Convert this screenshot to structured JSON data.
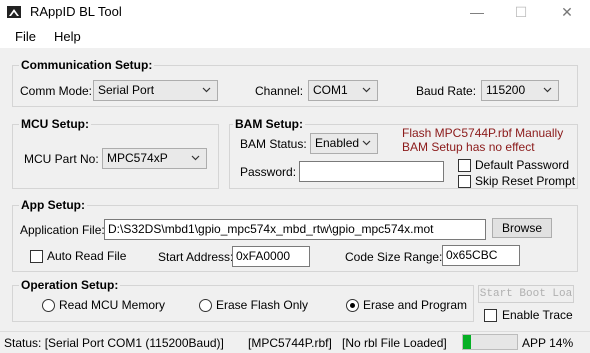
{
  "window": {
    "title": "RAppID BL Tool",
    "minimize": "—",
    "maximize": "☐",
    "close": "✕"
  },
  "menu": {
    "file": "File",
    "help": "Help"
  },
  "comm": {
    "title": "Communication Setup:",
    "mode_label": "Comm Mode:",
    "mode_value": "Serial Port",
    "channel_label": "Channel:",
    "channel_value": "COM1",
    "baud_label": "Baud Rate:",
    "baud_value": "115200"
  },
  "mcu": {
    "title": "MCU Setup:",
    "part_label": "MCU Part No:",
    "part_value": "MPC574xP"
  },
  "bam": {
    "title": "BAM Setup:",
    "status_label": "BAM Status:",
    "status_value": "Enabled",
    "note_line1": "Flash MPC5744P.rbf Manually",
    "note_line2": "BAM Setup has no effect",
    "password_label": "Password:",
    "password_value": "",
    "default_password": "Default Password",
    "skip_reset": "Skip Reset Prompt"
  },
  "app": {
    "title": "App Setup:",
    "file_label": "Application File:",
    "file_value": "D:\\S32DS\\mbd1\\gpio_mpc574x_mbd_rtw\\gpio_mpc574x.mot",
    "browse": "Browse",
    "auto_read": "Auto Read File",
    "start_label": "Start Address:",
    "start_value": "0xFA0000",
    "size_label": "Code Size Range:",
    "size_value": "0x65CBC"
  },
  "op": {
    "title": "Operation Setup:",
    "read": "Read MCU Memory",
    "erase": "Erase Flash Only",
    "erase_program": "Erase and Program",
    "selected": "Erase and Program",
    "start_boot": "Start Boot Loa",
    "enable_trace": "Enable Trace"
  },
  "status": {
    "text": "Status: [Serial Port COM1 (115200Baud)]",
    "rbf": "[MPC5744P.rbf]",
    "rbl": "[No rbl File Loaded]",
    "progress_percent": 14,
    "app_label": "APP 14%"
  },
  "colors": {
    "progress": "#06b025",
    "note": "#8b1a1a"
  }
}
